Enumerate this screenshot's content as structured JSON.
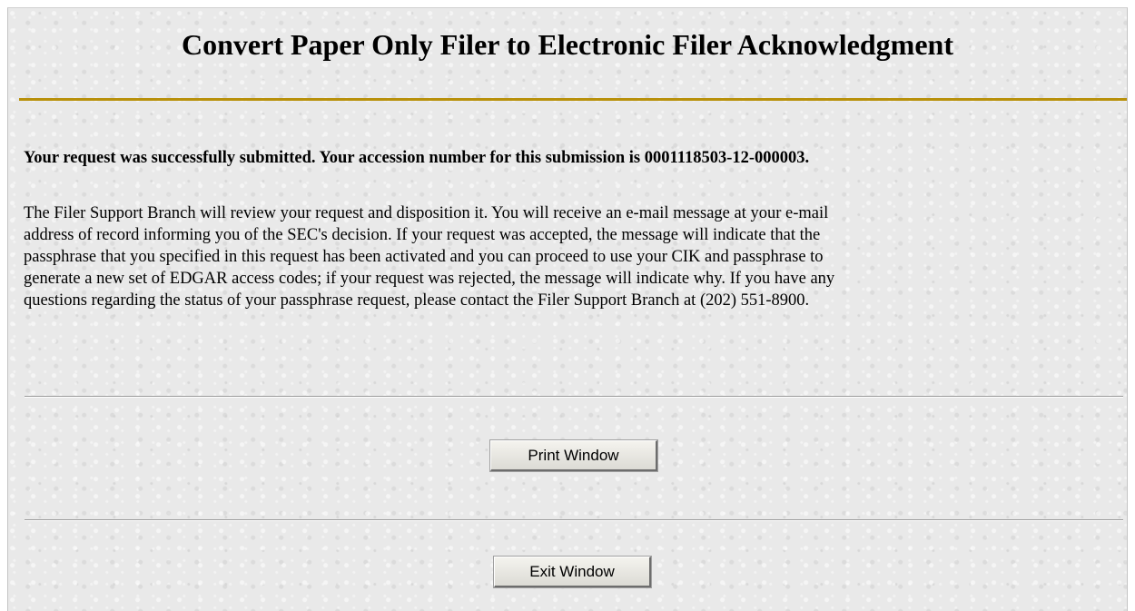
{
  "page": {
    "title": "Convert Paper Only Filer to Electronic Filer Acknowledgment"
  },
  "confirmation": {
    "message": "Your request was successfully submitted. Your accession number for this submission is 0001118503-12-000003."
  },
  "info": {
    "lines": [
      "The Filer Support Branch will review your request and disposition it. You will receive an e-mail message at your e-mail",
      "address of record informing you of the SEC's decision. If your request was accepted, the message will indicate that the",
      "passphrase that you specified in this request has been activated and you can proceed to use your CIK and passphrase to",
      "generate a new set of EDGAR access codes; if your request was rejected, the message will indicate why. If you have any",
      "questions regarding the status of your passphrase request, please contact the Filer Support Branch at (202) 551-8900."
    ]
  },
  "buttons": {
    "print_label": "Print Window",
    "exit_label": "Exit Window"
  },
  "colors": {
    "accent_rule": "#b8900a",
    "background": "#e9e9e9"
  }
}
